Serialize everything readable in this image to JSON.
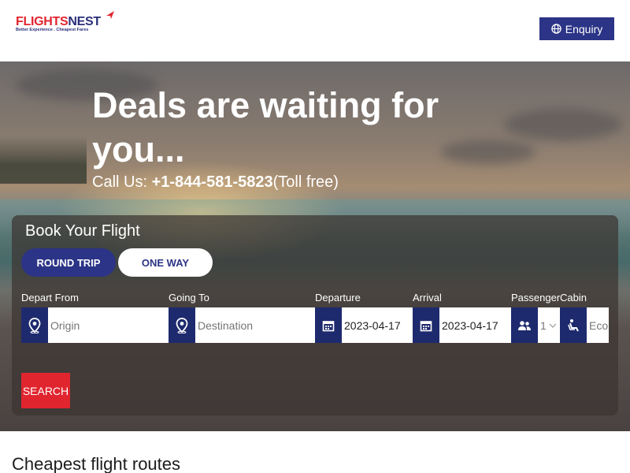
{
  "header": {
    "logo_part1": "FLIGHTS",
    "logo_part2": "NEST",
    "logo_tagline": "Better Experience . Cheapest Fares",
    "enquiry_label": "Enquiry",
    "enquiry_icon": "globe-icon"
  },
  "hero": {
    "title": "Deals are waiting for you...",
    "call_prefix": "Call Us: ",
    "phone": "+1-844-581-5823",
    "call_suffix": "(Toll free)"
  },
  "booking": {
    "title": "Book Your Flight",
    "trip_types": [
      "ROUND TRIP",
      "ONE WAY"
    ],
    "selected_trip": "ROUND TRIP",
    "fields": {
      "depart_from": {
        "label": "Depart From",
        "placeholder": "Origin",
        "icon": "location-pin-icon"
      },
      "going_to": {
        "label": "Going To",
        "placeholder": "Destination",
        "icon": "location-pin-icon"
      },
      "departure": {
        "label": "Departure",
        "value": "2023-04-17",
        "icon": "calendar-icon"
      },
      "arrival": {
        "label": "Arrival",
        "value": "2023-04-17",
        "icon": "calendar-icon"
      },
      "passenger": {
        "label": "Passenger",
        "value": "1",
        "icon": "people-icon"
      },
      "cabin": {
        "label": "Cabin",
        "value": "Econ",
        "icon": "seat-icon"
      }
    },
    "search_label": "SEARCH"
  },
  "section": {
    "title": "Cheapest flight routes"
  },
  "colors": {
    "brand_blue": "#2b3486",
    "brand_red": "#e0252f",
    "icon_bg": "#1e2a6e"
  }
}
